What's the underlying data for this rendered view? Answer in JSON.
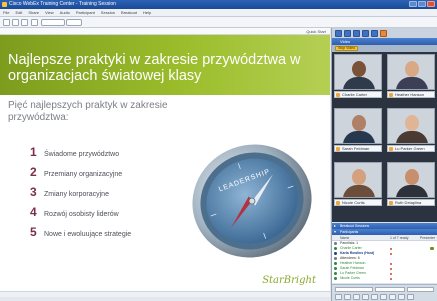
{
  "window": {
    "title": "Cisco WebEx Training Center - Training Session"
  },
  "menu": {
    "items": [
      "File",
      "Edit",
      "Share",
      "View",
      "Audio",
      "Participant",
      "Session",
      "Breakout",
      "Help"
    ]
  },
  "toolbar": {
    "tab_labels": [
      "",
      ""
    ]
  },
  "quick_start": {
    "label": "Quick Start"
  },
  "slide": {
    "title": "Najlepsze praktyki w zakresie przywództwa w organizacjach światowej klasy",
    "subtitle": "Pięć najlepszych praktyk w zakresie przywództwa:",
    "practices": [
      {
        "num": "1",
        "text": "Świadome przywództwo"
      },
      {
        "num": "2",
        "text": "Przemiany organizacyjne"
      },
      {
        "num": "3",
        "text": "Zmiany korporacyjne"
      },
      {
        "num": "4",
        "text": "Rozwój osobisty liderów"
      },
      {
        "num": "5",
        "text": "Nowe i ewoluujące strategie"
      }
    ],
    "compass_text": "LEADERSHIP",
    "brand": "StarBright",
    "accent_color": "#8db229",
    "number_color": "#7a2d4d"
  },
  "panel": {
    "video_header": "Video",
    "video_button": "Stop Video",
    "tiles": [
      {
        "name": "Charlie Carter"
      },
      {
        "name": "Heather Hanson"
      },
      {
        "name": "Sarah Feldman"
      },
      {
        "name": "Lu Parker Green"
      },
      {
        "name": "Nicole Curtis"
      },
      {
        "name": "Ruth Delaplina"
      }
    ],
    "breakout_header": "Breakout Sessions",
    "participants_header": "Participants",
    "participants_cols": {
      "name": "Name",
      "count": "1 of 7 ready",
      "pres": "Presenter"
    },
    "groups": [
      {
        "label": "Panelists: 1"
      },
      {
        "label": "Attendees: 6"
      }
    ],
    "participants": [
      {
        "name": "Charlie Carter",
        "color": "#2d8a3a"
      },
      {
        "name": "Karla Rowlins (Host)",
        "color": "#1f3f8a"
      },
      {
        "name": "Heather Hanson",
        "color": "#2d8a3a"
      },
      {
        "name": "Sarah Feldman",
        "color": "#2d8a3a"
      },
      {
        "name": "Lu Parker Green",
        "color": "#2d8a3a"
      },
      {
        "name": "Nicole Curtis",
        "color": "#2d8a3a"
      },
      {
        "name": "Ruth Delaplina",
        "color": "#2d8a3a"
      }
    ],
    "chat_placeholder": ""
  }
}
